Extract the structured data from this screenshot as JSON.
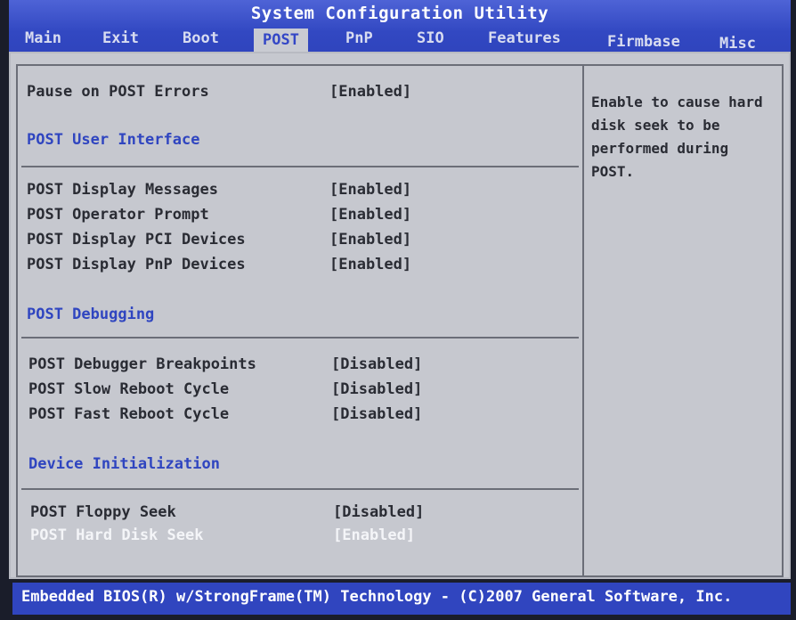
{
  "title": "System Configuration Utility",
  "tabs": [
    {
      "label": "Main"
    },
    {
      "label": "Exit"
    },
    {
      "label": "Boot"
    },
    {
      "label": "POST"
    },
    {
      "label": "PnP"
    },
    {
      "label": "SIO"
    },
    {
      "label": "Features"
    },
    {
      "label": "Firmbase"
    },
    {
      "label": "Misc"
    }
  ],
  "active_tab": "POST",
  "settings": {
    "pause_on_post_errors": {
      "label": "Pause on POST Errors",
      "value": "[Enabled]"
    },
    "section_ui": "POST User Interface",
    "display_messages": {
      "label": "POST Display Messages",
      "value": "[Enabled]"
    },
    "operator_prompt": {
      "label": "POST Operator Prompt",
      "value": "[Enabled]"
    },
    "display_pci": {
      "label": "POST Display PCI Devices",
      "value": "[Enabled]"
    },
    "display_pnp": {
      "label": "POST Display PnP Devices",
      "value": "[Enabled]"
    },
    "section_debug": "POST Debugging",
    "debugger_breakpoints": {
      "label": "POST Debugger Breakpoints",
      "value": "[Disabled]"
    },
    "slow_reboot": {
      "label": "POST Slow Reboot Cycle",
      "value": "[Disabled]"
    },
    "fast_reboot": {
      "label": "POST Fast Reboot Cycle",
      "value": "[Disabled]"
    },
    "section_device": "Device Initialization",
    "floppy_seek": {
      "label": "POST Floppy Seek",
      "value": "[Disabled]"
    },
    "hard_disk_seek": {
      "label": "POST Hard Disk Seek",
      "value": "[Enabled]"
    }
  },
  "help_text": "Enable to cause hard\ndisk seek to be\nperformed during\nPOST.",
  "footer": "Embedded BIOS(R) w/StrongFrame(TM) Technology - (C)2007 General Software, Inc."
}
